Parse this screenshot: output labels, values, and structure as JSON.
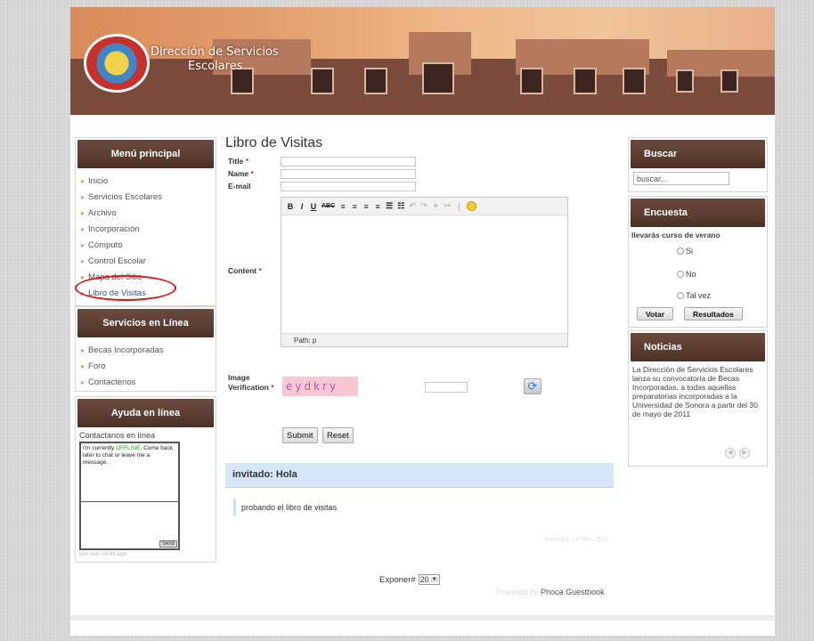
{
  "header": {
    "site_title_line1": "Dirección de Servicios",
    "site_title_line2": "Escolares"
  },
  "menu_principal": {
    "title": "Menú principal",
    "items": [
      "Inicio",
      "Servicios Escolares",
      "Archivo",
      "Incorporación",
      "Cómputo",
      "Control Escolar",
      "Mapa del Sitio",
      "Libro de Visitas"
    ],
    "active_index": 7
  },
  "servicios_linea": {
    "title": "Servicios en Línea",
    "items": [
      "Becas Incorporadas",
      "Foro",
      "Contactenos"
    ]
  },
  "ayuda": {
    "title": "Ayuda en línea",
    "subtitle": "Contactanos en línea",
    "chat_prefix": "I'm currently ",
    "chat_status": "OFFLINE",
    "chat_suffix": ". Come back later to chat or leave me a message.",
    "send_label": "Send",
    "last_seen": "last seen 5d 8h ago"
  },
  "guestbook": {
    "title": "Libro de Visitas",
    "labels": {
      "title": "Title",
      "name": "Name",
      "email": "E-mail",
      "content": "Content",
      "image_verification_1": "Image",
      "image_verification_2": "Verification"
    },
    "required_mark": "*",
    "editor_path": "Path: p",
    "captcha_text": "eydkry",
    "submit_label": "Submit",
    "reset_label": "Reset",
    "entry": {
      "header": "invitado: Hola",
      "body": "probando el libro de visitas",
      "date": "Thursday, 26 May 2011"
    },
    "exponer_label": "Exponer#",
    "exponer_value": "20",
    "powered_by": "Powered by",
    "powered_name": "Phoca Guestbook"
  },
  "buscar": {
    "title": "Buscar",
    "placeholder": "buscar..."
  },
  "encuesta": {
    "title": "Encuesta",
    "question": "llevarás curso de verano",
    "options": [
      "Si",
      "No",
      "Tal vez"
    ],
    "vote_label": "Votar",
    "results_label": "Resultados"
  },
  "noticias": {
    "title": "Noticias",
    "text": "La Dirección de Servicios Escolares lanza su convocatoria de Becas Incorporadas, a todas aquellas preparatorias incorporadas a la Universidad de Sonora a partir del 30 de mayo de 2011"
  },
  "colors": {
    "module_header": "#5b3c30",
    "bullet": "#e89a3c",
    "link_active": "#2a58a8",
    "highlight_oval": "#e01515",
    "entry_header_bg": "#d6e7f7"
  }
}
